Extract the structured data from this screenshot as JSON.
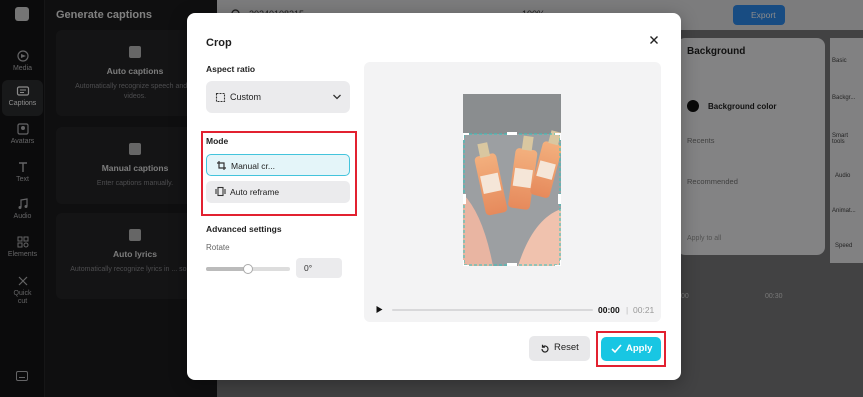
{
  "sidebar": {
    "items": [
      {
        "label": "Media",
        "icon": "media-icon"
      },
      {
        "label": "Captions",
        "icon": "captions-icon"
      },
      {
        "label": "Avatars",
        "icon": "avatars-icon"
      },
      {
        "label": "Text",
        "icon": "text-icon"
      },
      {
        "label": "Audio",
        "icon": "audio-icon"
      },
      {
        "label": "Elements",
        "icon": "elements-icon"
      },
      {
        "label": "Quick cut",
        "icon": "quick-cut-icon"
      }
    ]
  },
  "panel": {
    "title": "Generate captions",
    "cards": [
      {
        "title": "Auto captions",
        "desc": "Automatically recognize speech and ... videos."
      },
      {
        "title": "Manual captions",
        "desc": "Enter captions manually."
      },
      {
        "title": "Auto lyrics",
        "desc": "Automatically recognize lyrics in ... songs."
      }
    ]
  },
  "topbar": {
    "file_name": "20240108215...",
    "zoom": "100%",
    "export_label": "Export"
  },
  "background_panel": {
    "title": "Background",
    "color_label": "Background color",
    "recents_label": "Recents",
    "recommended_label": "Recommended",
    "apply_all": "Apply to all"
  },
  "right_tabs": [
    "Basic",
    "Backgr...",
    "Smart tools",
    "Audio",
    "Animat...",
    "Speed"
  ],
  "timeline": {
    "t1": "00",
    "t2": "00:30"
  },
  "modal": {
    "title": "Crop",
    "aspect_ratio_label": "Aspect ratio",
    "aspect_ratio_value": "Custom",
    "mode_label": "Mode",
    "mode_manual": "Manual cr...",
    "mode_auto": "Auto reframe",
    "advanced_label": "Advanced settings",
    "rotate_label": "Rotate",
    "rotate_value": "0°",
    "rotate_level": 0.5,
    "time_current": "00:00",
    "time_total": "00:21",
    "reset_label": "Reset",
    "apply_label": "Apply"
  },
  "colors": {
    "accent": "#18c6e3",
    "highlight": "#e22130"
  }
}
